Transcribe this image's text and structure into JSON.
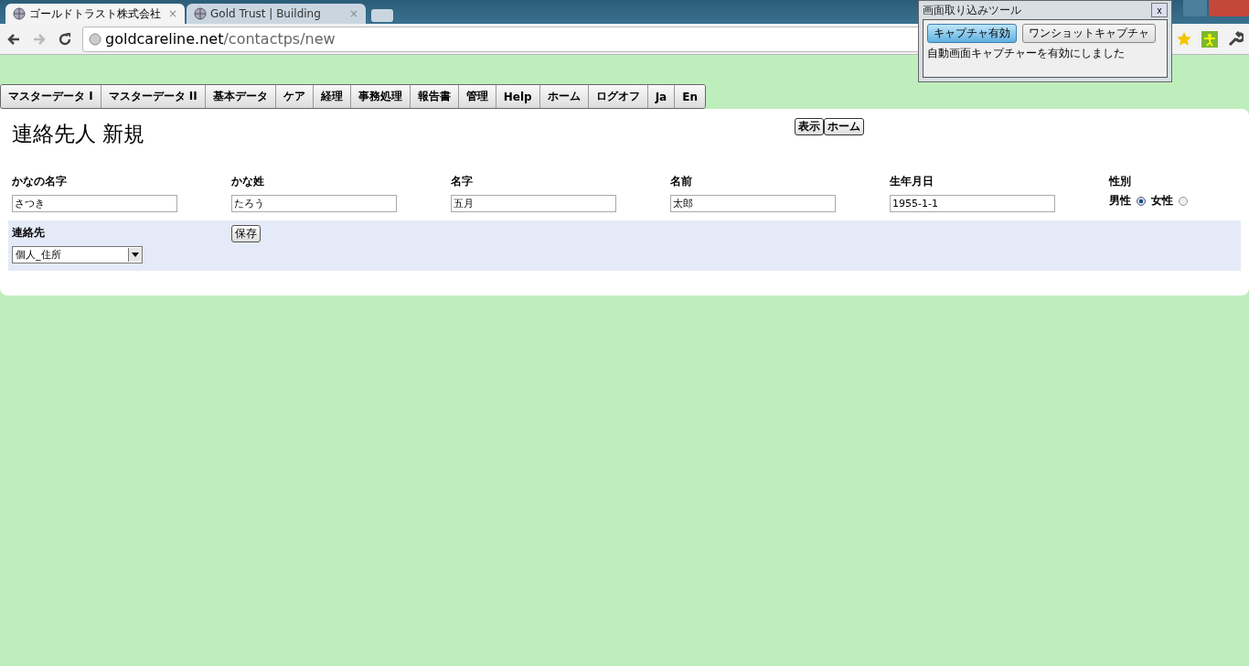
{
  "browser": {
    "tabs": [
      {
        "title": "ゴールドトラスト株式会社",
        "close": "×",
        "selected": true
      },
      {
        "title": "Gold Trust | Building",
        "close": "×",
        "selected": false
      }
    ],
    "address": {
      "domain": "goldcareline.net",
      "path": "/contactps/new"
    }
  },
  "menu": [
    {
      "label": "マスターデータ I"
    },
    {
      "label": "マスターデータ II"
    },
    {
      "label": "基本データ"
    },
    {
      "label": "ケア"
    },
    {
      "label": "経理"
    },
    {
      "label": "事務処理"
    },
    {
      "label": "報告書"
    },
    {
      "label": "管理"
    },
    {
      "label": "Help"
    },
    {
      "label": "ホーム"
    },
    {
      "label": "ログオフ"
    },
    {
      "label": "Ja"
    },
    {
      "label": "En"
    }
  ],
  "page": {
    "title": "連絡先人 新規",
    "actions": [
      "表示",
      "ホーム"
    ],
    "fields": [
      {
        "label": "かなの名字",
        "value": "さつき"
      },
      {
        "label": "かな姓",
        "value": "たろう"
      },
      {
        "label": "名字",
        "value": "五月"
      },
      {
        "label": "名前",
        "value": "太郎"
      },
      {
        "label": "生年月日",
        "value": "1955-1-1"
      }
    ],
    "gender": {
      "label": "性別",
      "options": [
        {
          "label": "男性",
          "selected": true
        },
        {
          "label": "女性",
          "selected": false
        }
      ]
    },
    "contact": {
      "label": "連絡先",
      "value": "個人_住所"
    },
    "save": "保存"
  },
  "capture_tool": {
    "title": "画面取り込みツール",
    "close": "x",
    "buttons": [
      {
        "label": "キャプチャ有効",
        "selected": true
      },
      {
        "label": "ワンショットキャプチャ",
        "selected": false
      }
    ],
    "message": "自動画面キャプチャーを有効にしました"
  }
}
